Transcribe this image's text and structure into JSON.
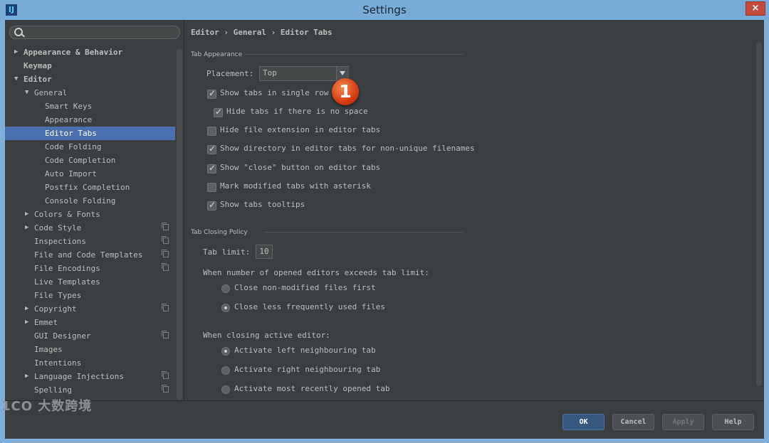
{
  "window": {
    "title": "Settings",
    "app_icon": "IJ",
    "close": "×"
  },
  "search": {
    "placeholder": ""
  },
  "tree": [
    {
      "label": "Appearance & Behavior",
      "indent": 0,
      "arrow": "collapsed",
      "bold": true
    },
    {
      "label": "Keymap",
      "indent": 0,
      "arrow": "none",
      "bold": true
    },
    {
      "label": "Editor",
      "indent": 0,
      "arrow": "expanded",
      "bold": true
    },
    {
      "label": "General",
      "indent": 1,
      "arrow": "expanded"
    },
    {
      "label": "Smart Keys",
      "indent": 2,
      "arrow": "none"
    },
    {
      "label": "Appearance",
      "indent": 2,
      "arrow": "none"
    },
    {
      "label": "Editor Tabs",
      "indent": 2,
      "arrow": "none",
      "selected": true
    },
    {
      "label": "Code Folding",
      "indent": 2,
      "arrow": "none"
    },
    {
      "label": "Code Completion",
      "indent": 2,
      "arrow": "none"
    },
    {
      "label": "Auto Import",
      "indent": 2,
      "arrow": "none"
    },
    {
      "label": "Postfix Completion",
      "indent": 2,
      "arrow": "none"
    },
    {
      "label": "Console Folding",
      "indent": 2,
      "arrow": "none"
    },
    {
      "label": "Colors & Fonts",
      "indent": 1,
      "arrow": "collapsed"
    },
    {
      "label": "Code Style",
      "indent": 1,
      "arrow": "collapsed",
      "copy": true
    },
    {
      "label": "Inspections",
      "indent": 1,
      "arrow": "none",
      "copy": true
    },
    {
      "label": "File and Code Templates",
      "indent": 1,
      "arrow": "none",
      "copy": true
    },
    {
      "label": "File Encodings",
      "indent": 1,
      "arrow": "none",
      "copy": true
    },
    {
      "label": "Live Templates",
      "indent": 1,
      "arrow": "none"
    },
    {
      "label": "File Types",
      "indent": 1,
      "arrow": "none"
    },
    {
      "label": "Copyright",
      "indent": 1,
      "arrow": "collapsed",
      "copy": true
    },
    {
      "label": "Emmet",
      "indent": 1,
      "arrow": "collapsed"
    },
    {
      "label": "GUI Designer",
      "indent": 1,
      "arrow": "none",
      "copy": true
    },
    {
      "label": "Images",
      "indent": 1,
      "arrow": "none"
    },
    {
      "label": "Intentions",
      "indent": 1,
      "arrow": "none"
    },
    {
      "label": "Language Injections",
      "indent": 1,
      "arrow": "collapsed",
      "copy": true
    },
    {
      "label": "Spelling",
      "indent": 1,
      "arrow": "none",
      "copy": true
    }
  ],
  "breadcrumb": "Editor › General › Editor Tabs",
  "tab_appearance": {
    "title": "Tab Appearance",
    "placement_label": "Placement:",
    "placement_value": "Top",
    "options": [
      {
        "label": "Show tabs in single row",
        "checked": true
      },
      {
        "label": "Hide tabs if there is no space",
        "checked": true
      },
      {
        "label": "Hide file extension in editor tabs",
        "checked": false
      },
      {
        "label": "Show directory in editor tabs for non-unique filenames",
        "checked": true
      },
      {
        "label": "Show \"close\" button on editor tabs",
        "checked": true
      },
      {
        "label": "Mark modified tabs with asterisk",
        "checked": false
      },
      {
        "label": "Show tabs tooltips",
        "checked": true
      }
    ]
  },
  "tab_closing": {
    "title": "Tab Closing Policy",
    "limit_label": "Tab limit:",
    "limit_value": "10",
    "exceeds_label": "When number of opened editors exceeds tab limit:",
    "exceeds_options": [
      {
        "label": "Close non-modified files first",
        "selected": false
      },
      {
        "label": "Close less frequently used files",
        "selected": true
      }
    ],
    "closing_label": "When closing active editor:",
    "closing_options": [
      {
        "label": "Activate left neighbouring tab",
        "selected": true
      },
      {
        "label": "Activate right neighbouring tab",
        "selected": false
      },
      {
        "label": "Activate most recently opened tab",
        "selected": false
      }
    ]
  },
  "marker": "1",
  "buttons": {
    "ok": "OK",
    "cancel": "Cancel",
    "apply": "Apply",
    "help": "Help"
  },
  "watermark": "1CO 大数跨境"
}
